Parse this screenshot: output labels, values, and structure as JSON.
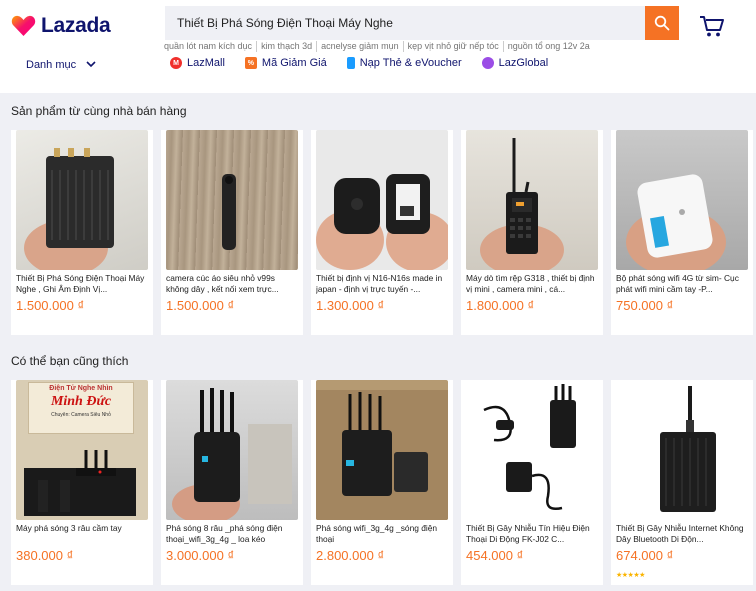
{
  "brand": {
    "name": "Lazada"
  },
  "search": {
    "value": "Thiết Bị Phá Sóng Điện Thoại Máy Nghe"
  },
  "suggestions": [
    "quần lót nam kích dục",
    "kim thạch 3d",
    "acnelyse giảm mụn",
    "kẹp vịt nhỏ giữ nếp tóc",
    "nguồn tổ ong 12v 2a"
  ],
  "category_menu": {
    "label": "Danh mục"
  },
  "nav": [
    {
      "label": "LazMall",
      "icon": "lazmall-icon",
      "color": "#f0302c"
    },
    {
      "label": "Mã Giảm Giá",
      "icon": "voucher-icon",
      "color": "#f57224"
    },
    {
      "label": "Nạp Thẻ & eVoucher",
      "icon": "phone-topup-icon",
      "color": "#1a9cff"
    },
    {
      "label": "LazGlobal",
      "icon": "lazglobal-icon",
      "color": "#9b4de6"
    }
  ],
  "sections": [
    {
      "title": "Sản phẩm từ cùng nhà bán hàng",
      "products": [
        {
          "name": "Thiết Bị Phá Sóng Điện Thoại Máy Nghe , Ghi Âm Định Vị...",
          "price": "1.500.000 ₫"
        },
        {
          "name": "camera cúc áo siêu nhỏ v99s không dây , kết nối xem trực...",
          "price": "1.500.000 ₫"
        },
        {
          "name": "Thiết bị định vị N16-N16s made in japan - định vị trực tuyến -...",
          "price": "1.300.000 ₫"
        },
        {
          "name": "Máy dò tìm rệp G318 , thiết bị định vị mini , camera mini , cá...",
          "price": "1.800.000 ₫"
        },
        {
          "name": "Bộ phát sóng wifi 4G từ sim- Cục phát wifi mini cầm tay -P...",
          "price": "750.000 ₫"
        }
      ]
    },
    {
      "title": "Có thể bạn cũng thích",
      "products": [
        {
          "name": "Máy phá sóng 3 râu cầm tay",
          "price": "380.000 ₫",
          "image_text": [
            "Điện Tử Nghe Nhìn",
            "Minh Đức",
            "Chuyên: Camera Siêu Nhỏ"
          ]
        },
        {
          "name": "Phá sóng 8 râu _phá sóng điện thoại_wifi_3g_4g _ loa kéo",
          "price": "3.000.000 ₫"
        },
        {
          "name": "Phá sóng wifi_3g_4g _sóng điện thoại",
          "price": "2.800.000 ₫"
        },
        {
          "name": "Thiết Bị Gây Nhiễu Tín Hiệu Điện Thoại Di Động FK-J02 C...",
          "price": "454.000 ₫"
        },
        {
          "name": "Thiết Bị Gây Nhiễu Internet Không Dây Bluetooth Di Độn...",
          "price": "674.000 ₫",
          "rating": 5
        }
      ]
    }
  ]
}
